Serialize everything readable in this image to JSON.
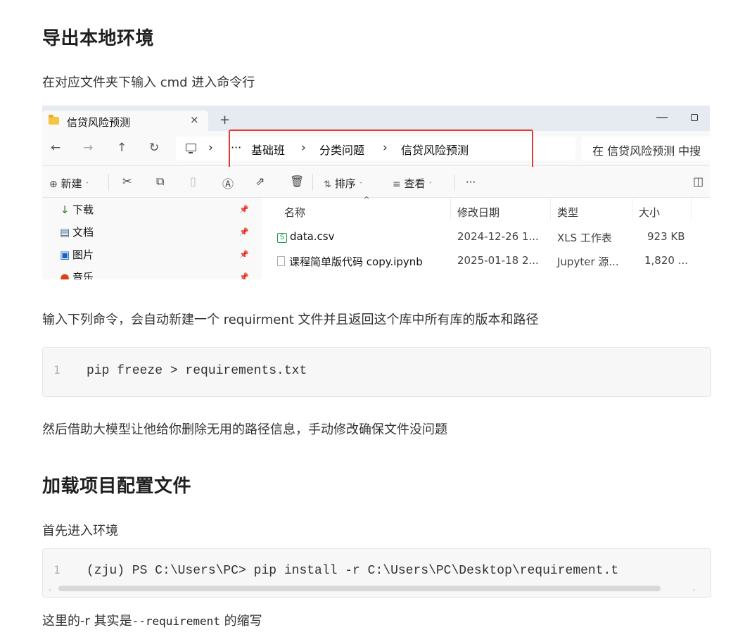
{
  "section1": {
    "title": "导出本地环境",
    "intro": "在对应文件夹下输入 cmd 进入命令行"
  },
  "explorer": {
    "tab_title": "信贷风险预测",
    "tab_close": "×",
    "new_tab": "+",
    "win_minimize": "—",
    "nav": {
      "back": "←",
      "forward": "→",
      "up": "↑",
      "refresh": "↻"
    },
    "breadcrumbs": [
      "···",
      "基础班",
      "分类问题",
      "信贷风险预测"
    ],
    "crumb_separator": "›",
    "search_placeholder": "在 信贷风险预测 中搜",
    "toolbar": {
      "new": "新建",
      "sort": "排序",
      "view": "查看",
      "more": "···"
    },
    "nav_items": [
      {
        "icon": "download-icon",
        "glyph": "↓",
        "label": "下载",
        "color": "#2e7d32"
      },
      {
        "icon": "document-icon",
        "glyph": "▤",
        "label": "文档",
        "color": "#4a6a8a"
      },
      {
        "icon": "pictures-icon",
        "glyph": "▣",
        "label": "图片",
        "color": "#1565c0"
      },
      {
        "icon": "music-icon",
        "glyph": "●",
        "label": "音乐",
        "color": "#d84315"
      }
    ],
    "columns": [
      "名称",
      "修改日期",
      "类型",
      "大小"
    ],
    "files": [
      {
        "icon": "csv-icon",
        "name": "data.csv",
        "modified": "2024-12-26 1...",
        "type": "XLS 工作表",
        "size": "923 KB"
      },
      {
        "icon": "document-icon",
        "name": "课程简单版代码 copy.ipynb",
        "modified": "2025-01-18 2...",
        "type": "Jupyter 源...",
        "size": "1,820 ..."
      }
    ],
    "highlight_color": "#e53935"
  },
  "para2": "输入下列命令，会自动新建一个 requirment 文件并且返回这个库中所有库的版本和路径",
  "code1": {
    "line_no": "1",
    "code": "pip freeze > requirements.txt"
  },
  "para3": "然后借助大模型让他给你删除无用的路径信息，手动修改确保文件没问题",
  "section2": {
    "title": "加载项目配置文件",
    "intro": "首先进入环境"
  },
  "code2": {
    "line_no": "1",
    "code": "(zju) PS C:\\Users\\PC> pip install -r C:\\Users\\PC\\Desktop\\requirement.t"
  },
  "para4": {
    "prefix": "这里的-r 其实是",
    "code": "--requirement",
    "suffix": " 的缩写"
  }
}
